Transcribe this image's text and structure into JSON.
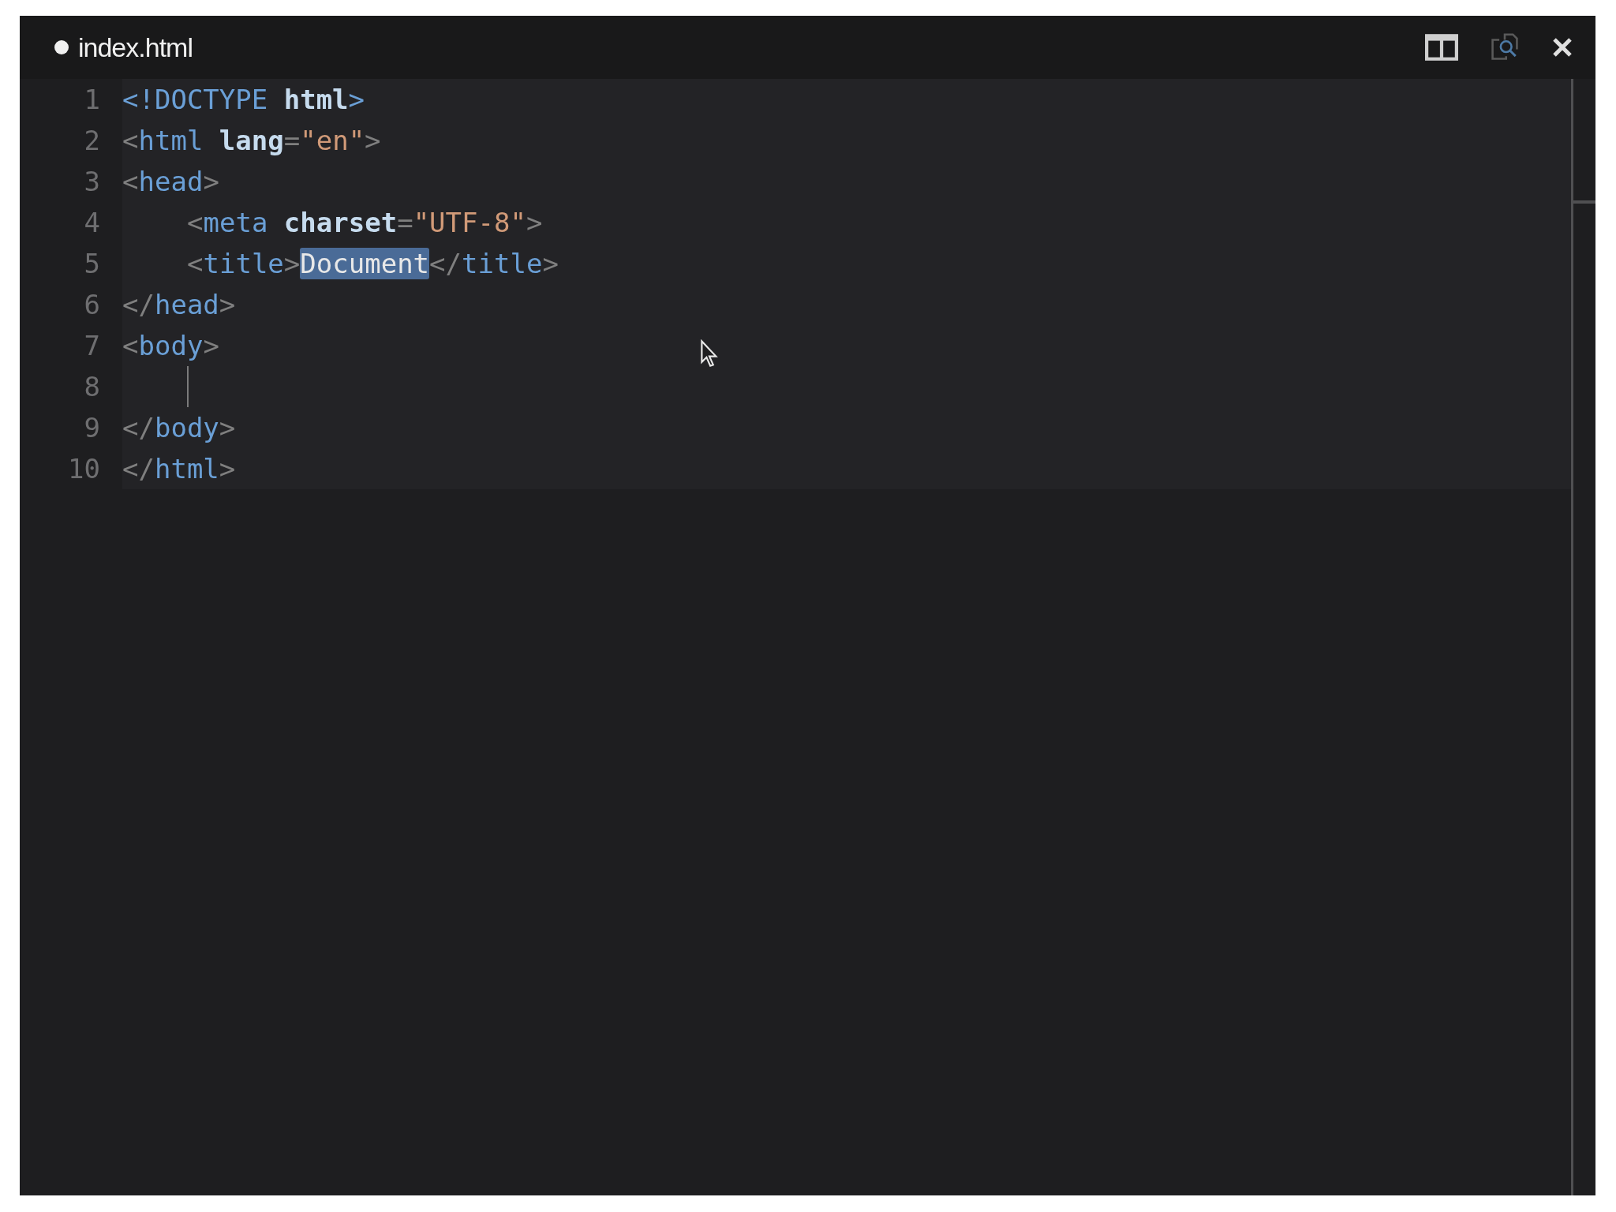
{
  "tab": {
    "title": "index.html",
    "modified": true
  },
  "lines": [
    {
      "number": "1",
      "indented": false,
      "cursor": false,
      "tokens": [
        {
          "text": "<!DOCTYPE",
          "kind": "tag",
          "selected": false
        },
        {
          "text": " html",
          "kind": "attr",
          "selected": false
        },
        {
          "text": ">",
          "kind": "tag",
          "selected": false
        }
      ]
    },
    {
      "number": "2",
      "indented": false,
      "cursor": false,
      "tokens": [
        {
          "text": "<",
          "kind": "punct",
          "selected": false
        },
        {
          "text": "html",
          "kind": "tag",
          "selected": false
        },
        {
          "text": " lang",
          "kind": "attr",
          "selected": false
        },
        {
          "text": "=",
          "kind": "punct",
          "selected": false
        },
        {
          "text": "\"en\"",
          "kind": "string",
          "selected": false
        },
        {
          "text": ">",
          "kind": "punct",
          "selected": false
        }
      ]
    },
    {
      "number": "3",
      "indented": false,
      "cursor": false,
      "tokens": [
        {
          "text": "<",
          "kind": "punct",
          "selected": false
        },
        {
          "text": "head",
          "kind": "tag",
          "selected": false
        },
        {
          "text": ">",
          "kind": "punct",
          "selected": false
        }
      ]
    },
    {
      "number": "4",
      "indented": true,
      "cursor": false,
      "tokens": [
        {
          "text": "<",
          "kind": "punct",
          "selected": false
        },
        {
          "text": "meta",
          "kind": "tag",
          "selected": false
        },
        {
          "text": " charset",
          "kind": "attr",
          "selected": false
        },
        {
          "text": "=",
          "kind": "punct",
          "selected": false
        },
        {
          "text": "\"UTF-8\"",
          "kind": "string",
          "selected": false
        },
        {
          "text": ">",
          "kind": "punct",
          "selected": false
        }
      ]
    },
    {
      "number": "5",
      "indented": true,
      "cursor": false,
      "tokens": [
        {
          "text": "<",
          "kind": "punct",
          "selected": false
        },
        {
          "text": "title",
          "kind": "tag",
          "selected": false
        },
        {
          "text": ">",
          "kind": "punct",
          "selected": false
        },
        {
          "text": "Document",
          "kind": "text",
          "selected": true
        },
        {
          "text": "</",
          "kind": "punct",
          "selected": false
        },
        {
          "text": "title",
          "kind": "tag",
          "selected": false
        },
        {
          "text": ">",
          "kind": "punct",
          "selected": false
        }
      ]
    },
    {
      "number": "6",
      "indented": false,
      "cursor": false,
      "tokens": [
        {
          "text": "</",
          "kind": "punct",
          "selected": false
        },
        {
          "text": "head",
          "kind": "tag",
          "selected": false
        },
        {
          "text": ">",
          "kind": "punct",
          "selected": false
        }
      ]
    },
    {
      "number": "7",
      "indented": false,
      "cursor": false,
      "tokens": [
        {
          "text": "<",
          "kind": "punct",
          "selected": false
        },
        {
          "text": "body",
          "kind": "tag",
          "selected": false
        },
        {
          "text": ">",
          "kind": "punct",
          "selected": false
        }
      ]
    },
    {
      "number": "8",
      "indented": true,
      "cursor": true
    },
    {
      "number": "9",
      "indented": false,
      "cursor": false,
      "tokens": [
        {
          "text": "</",
          "kind": "punct",
          "selected": false
        },
        {
          "text": "body",
          "kind": "tag",
          "selected": false
        },
        {
          "text": ">",
          "kind": "punct",
          "selected": false
        }
      ]
    },
    {
      "number": "10",
      "indented": false,
      "cursor": false,
      "tokens": [
        {
          "text": "</",
          "kind": "punct",
          "selected": false
        },
        {
          "text": "html",
          "kind": "tag",
          "selected": false
        },
        {
          "text": ">",
          "kind": "punct",
          "selected": false
        }
      ]
    }
  ]
}
